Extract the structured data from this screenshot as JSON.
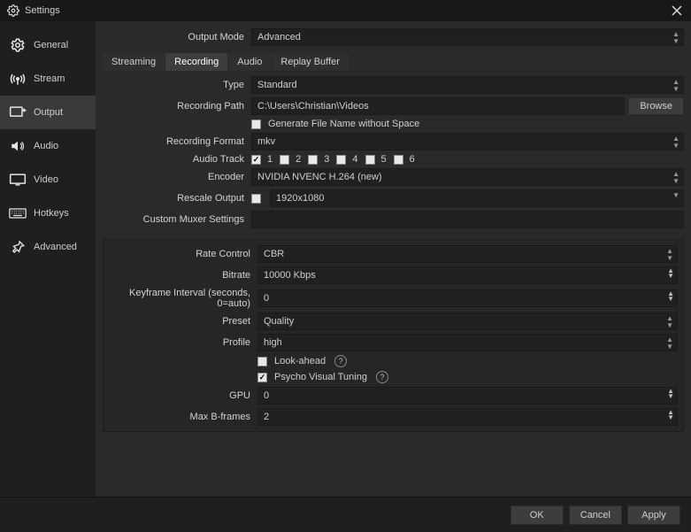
{
  "window": {
    "title": "Settings"
  },
  "sidebar": {
    "items": [
      {
        "label": "General"
      },
      {
        "label": "Stream"
      },
      {
        "label": "Output"
      },
      {
        "label": "Audio"
      },
      {
        "label": "Video"
      },
      {
        "label": "Hotkeys"
      },
      {
        "label": "Advanced"
      }
    ]
  },
  "outputMode": {
    "label": "Output Mode",
    "value": "Advanced"
  },
  "tabs": [
    "Streaming",
    "Recording",
    "Audio",
    "Replay Buffer"
  ],
  "recording": {
    "type": {
      "label": "Type",
      "value": "Standard"
    },
    "path": {
      "label": "Recording Path",
      "value": "C:\\Users\\Christian\\Videos",
      "browse": "Browse"
    },
    "noSpace": {
      "label": "Generate File Name without Space",
      "checked": false
    },
    "format": {
      "label": "Recording Format",
      "value": "mkv"
    },
    "audioTrack": {
      "label": "Audio Track",
      "tracks": [
        "1",
        "2",
        "3",
        "4",
        "5",
        "6"
      ],
      "checked": [
        true,
        false,
        false,
        false,
        false,
        false
      ]
    },
    "encoder": {
      "label": "Encoder",
      "value": "NVIDIA NVENC H.264 (new)"
    },
    "rescale": {
      "label": "Rescale Output",
      "checked": false,
      "value": "1920x1080"
    },
    "muxer": {
      "label": "Custom Muxer Settings",
      "value": ""
    }
  },
  "encoderPanel": {
    "rateControl": {
      "label": "Rate Control",
      "value": "CBR"
    },
    "bitrate": {
      "label": "Bitrate",
      "value": "10000 Kbps"
    },
    "keyframe": {
      "label": "Keyframe Interval (seconds, 0=auto)",
      "value": "0"
    },
    "preset": {
      "label": "Preset",
      "value": "Quality"
    },
    "profile": {
      "label": "Profile",
      "value": "high"
    },
    "lookAhead": {
      "label": "Look-ahead",
      "checked": false
    },
    "psycho": {
      "label": "Psycho Visual Tuning",
      "checked": true
    },
    "gpu": {
      "label": "GPU",
      "value": "0"
    },
    "maxB": {
      "label": "Max B-frames",
      "value": "2"
    }
  },
  "footer": {
    "ok": "OK",
    "cancel": "Cancel",
    "apply": "Apply"
  }
}
